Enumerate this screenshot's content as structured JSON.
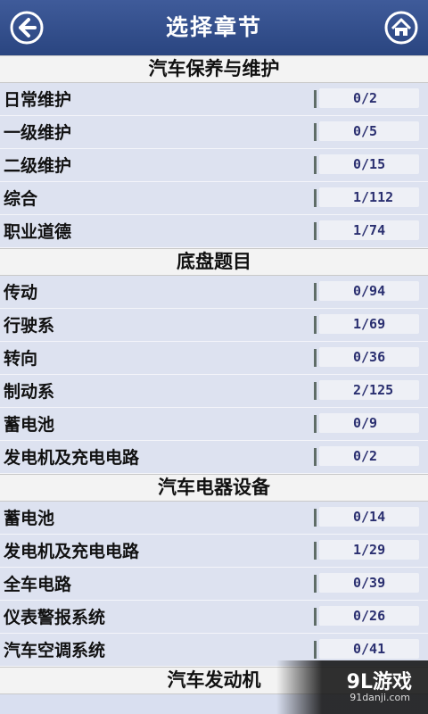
{
  "header": {
    "title": "选择章节",
    "back_icon": "back-arrow-icon",
    "home_icon": "home-icon"
  },
  "sections": [
    {
      "title": "汽车保养与维护",
      "items": [
        {
          "label": "日常维护",
          "count": "0/2"
        },
        {
          "label": "一级维护",
          "count": "0/5"
        },
        {
          "label": "二级维护",
          "count": "0/15"
        },
        {
          "label": "综合",
          "count": "1/112"
        },
        {
          "label": "职业道德",
          "count": "1/74"
        }
      ]
    },
    {
      "title": "底盘题目",
      "items": [
        {
          "label": "传动",
          "count": "0/94"
        },
        {
          "label": "行驶系",
          "count": "1/69"
        },
        {
          "label": "转向",
          "count": "0/36"
        },
        {
          "label": "制动系",
          "count": "2/125"
        },
        {
          "label": "蓄电池",
          "count": "0/9"
        },
        {
          "label": "发电机及充电电路",
          "count": "0/2"
        }
      ]
    },
    {
      "title": "汽车电器设备",
      "items": [
        {
          "label": "蓄电池",
          "count": "0/14"
        },
        {
          "label": "发电机及充电电路",
          "count": "1/29"
        },
        {
          "label": "全车电路",
          "count": "0/39"
        },
        {
          "label": "仪表警报系统",
          "count": "0/26"
        },
        {
          "label": "汽车空调系统",
          "count": "0/41"
        }
      ]
    },
    {
      "title": "汽车发动机",
      "items": []
    }
  ],
  "watermark": {
    "main": "9L游戏",
    "sub": "91danji.com"
  },
  "colors": {
    "titlebar": "#2f4b88",
    "row_bg": "#dde2f0",
    "section_bg": "#f3f3f3",
    "count_text": "#2a2f70"
  }
}
